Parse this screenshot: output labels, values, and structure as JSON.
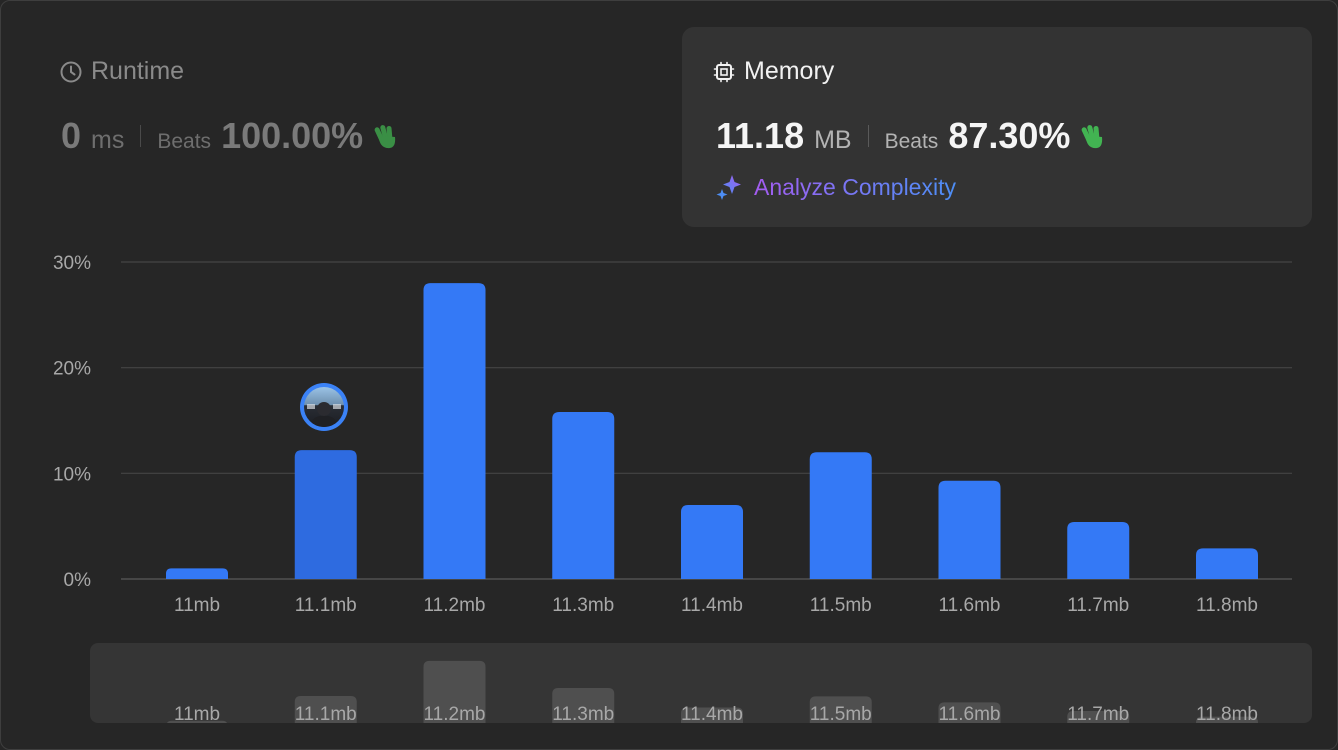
{
  "runtime": {
    "title": "Runtime",
    "value": "0",
    "unit": "ms",
    "beats_label": "Beats",
    "beats_pct": "100.00%"
  },
  "memory": {
    "title": "Memory",
    "value": "11.18",
    "unit": "MB",
    "beats_label": "Beats",
    "beats_pct": "87.30%",
    "analyze_label": "Analyze Complexity"
  },
  "colors": {
    "bar": "#3479f6",
    "bar_highlight": "#2e6be0",
    "minimap_bar": "#4f4f4f",
    "clap": "#3fae4f"
  },
  "icons": [
    "clock-icon",
    "cpu-icon",
    "clap-icon",
    "sparkle-icon",
    "avatar"
  ],
  "chart_data": {
    "type": "bar",
    "categories": [
      "11mb",
      "11.1mb",
      "11.2mb",
      "11.3mb",
      "11.4mb",
      "11.5mb",
      "11.6mb",
      "11.7mb",
      "11.8mb"
    ],
    "values": [
      1.0,
      12.2,
      28.0,
      15.8,
      7.0,
      12.0,
      9.3,
      5.4,
      2.9
    ],
    "highlight_index": 1,
    "ylim": [
      0,
      30
    ],
    "yticks": [
      "0%",
      "10%",
      "20%",
      "30%"
    ],
    "grid": true
  }
}
